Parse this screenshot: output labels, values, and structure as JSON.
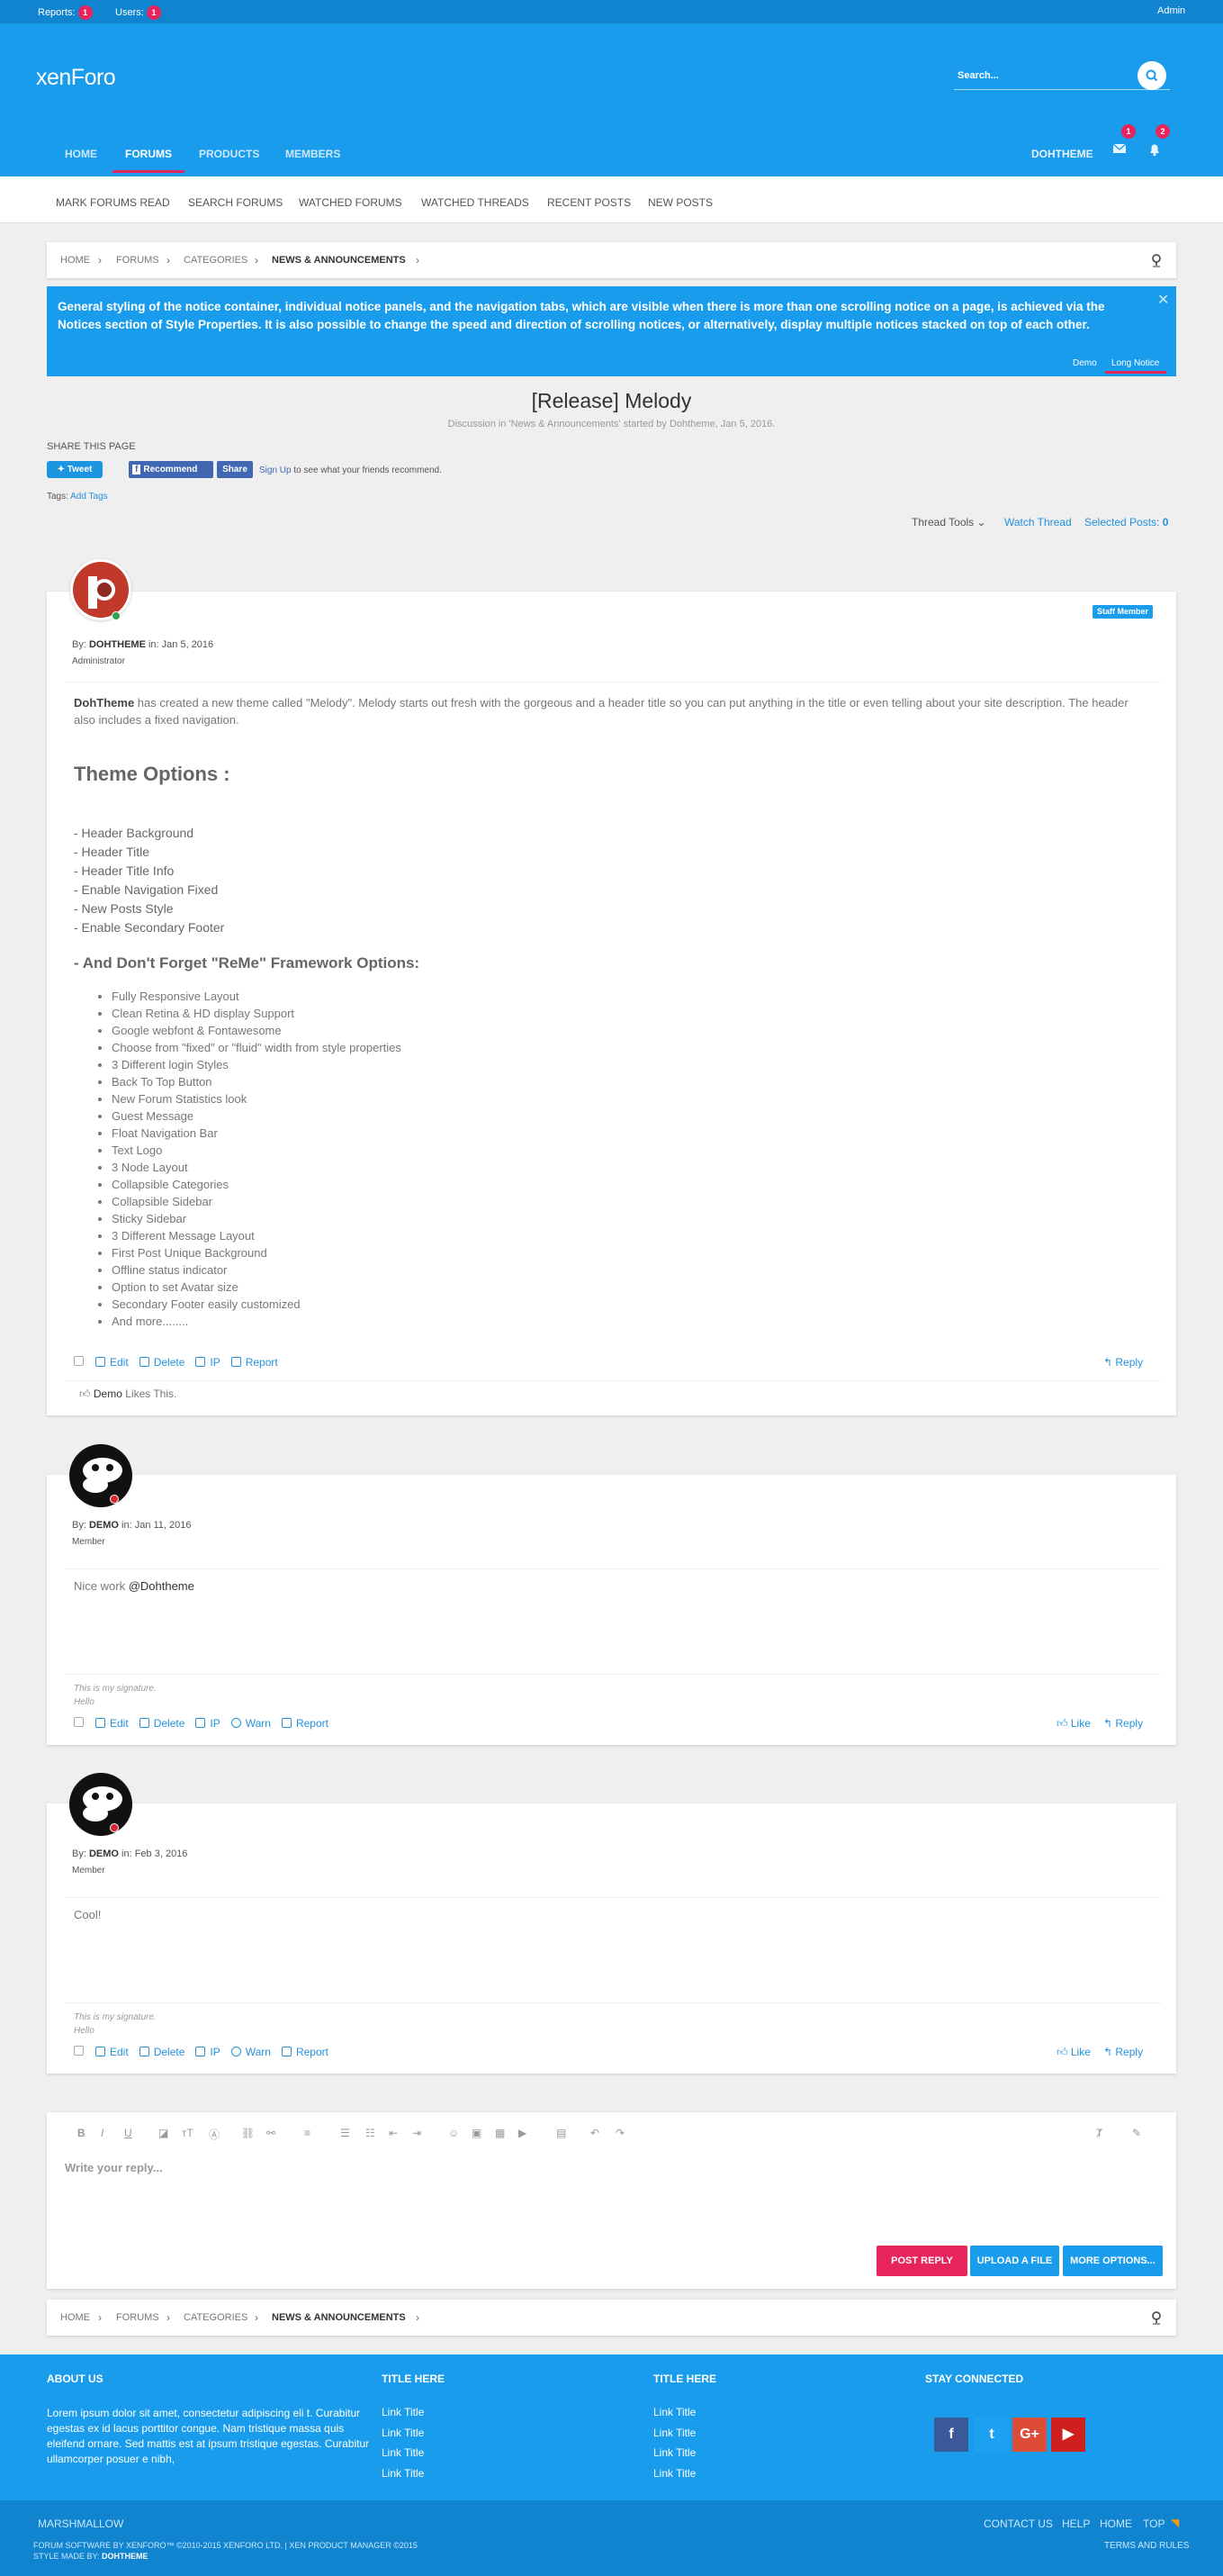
{
  "topbar": {
    "reports_label": "Reports:",
    "reports_count": "1",
    "users_label": "Users:",
    "users_count": "1",
    "admin": "Admin"
  },
  "header": {
    "logo": "xenForo",
    "search_placeholder": "Search...",
    "nav": [
      "HOME",
      "FORUMS",
      "PRODUCTS",
      "MEMBERS"
    ],
    "username": "DOHTHEME",
    "inbox_count": "1",
    "alerts_count": "2"
  },
  "subnav": [
    "MARK FORUMS READ",
    "SEARCH FORUMS",
    "WATCHED FORUMS",
    "WATCHED THREADS",
    "RECENT POSTS",
    "NEW POSTS"
  ],
  "breadcrumb": [
    "HOME",
    "FORUMS",
    "CATEGORIES",
    "NEWS & ANNOUNCEMENTS"
  ],
  "notice": {
    "text": "General styling of the notice container, individual notice panels, and the navigation tabs, which are visible when there is more than one scrolling notice on a page, is achieved via the Notices section of Style Properties. It is also possible to change the speed and direction of scrolling notices, or alternatively, display multiple notices stacked on top of each other.",
    "tabs": [
      "Demo",
      "Long Notice"
    ]
  },
  "thread": {
    "title": "[Release] Melody",
    "meta": "Discussion in 'News & Announcements' started by Dohtheme, Jan 5, 2016."
  },
  "share": {
    "title": "SHARE THIS PAGE",
    "tweet": "Tweet",
    "recommend": "Recommend",
    "share": "Share",
    "signup": "Sign Up",
    "signup_rest": "to see what your friends recommend.",
    "tags_label": "Tags:",
    "tags_link": "Add Tags"
  },
  "tools": {
    "thread_tools": "Thread Tools",
    "watch": "Watch Thread",
    "selected": "Selected Posts:",
    "selected_count": "0"
  },
  "post1": {
    "by": "By:",
    "author": "DOHTHEME",
    "in": "in: Jan 5, 2016",
    "role": "Administrator",
    "badge": "Staff Member",
    "intro_name": "DohTheme",
    "intro": " has created a new theme called \"Melody\". Melody starts out fresh with the gorgeous and a header title so you can put anything in the title or even telling about your site description. The header also includes a fixed navigation.",
    "options_title": "Theme Options :",
    "options": [
      "- Header Background",
      "- Header Title",
      "- Header Title Info",
      "- Enable Navigation Fixed",
      "- New Posts Style",
      "- Enable Secondary Footer"
    ],
    "framework_title": "- And Don't Forget \"ReMe\" Framework Options:",
    "features": [
      "Fully Responsive Layout",
      "Clean Retina & HD display Support",
      "Google webfont & Fontawesome",
      "Choose from \"fixed\" or \"fluid\" width from style properties",
      "3 Different login Styles",
      "Back To Top Button",
      "New Forum Statistics look",
      "Guest Message",
      "Float Navigation Bar",
      "Text Logo",
      "3 Node Layout",
      "Collapsible Categories",
      "Collapsible Sidebar",
      "Sticky Sidebar",
      "3 Different Message Layout",
      "First Post Unique Background",
      "Offline status indicator",
      "Option to set Avatar size",
      "Secondary Footer easily customized",
      "And more........"
    ],
    "actions": [
      "Edit",
      "Delete",
      "IP",
      "Report"
    ],
    "reply": "Reply",
    "likes_user": "Demo",
    "likes_rest": " Likes This."
  },
  "post2": {
    "by": "By:",
    "author": "DEMO",
    "in": "in: Jan 11, 2016",
    "role": "Member",
    "text": "Nice work ",
    "mention": "@Dohtheme",
    "sig1": "This is my signature.",
    "sig2": "Hello",
    "actions": [
      "Edit",
      "Delete",
      "IP",
      "Warn",
      "Report"
    ],
    "like": "Like",
    "reply": "Reply"
  },
  "post3": {
    "by": "By:",
    "author": "DEMO",
    "in": "in: Feb 3, 2016",
    "role": "Member",
    "text": "Cool!",
    "sig1": "This is my signature.",
    "sig2": "Hello",
    "actions": [
      "Edit",
      "Delete",
      "IP",
      "Warn",
      "Report"
    ],
    "like": "Like",
    "reply": "Reply"
  },
  "editor": {
    "placeholder": "Write your reply...",
    "post_reply": "POST REPLY",
    "upload": "UPLOAD A FILE",
    "more": "MORE OPTIONS..."
  },
  "footer": {
    "about_title": "ABOUT US",
    "about_text": "Lorem ipsum dolor sit amet, consectetur adipiscing eli t. Curabitur egestas ex id lacus porttitor congue. Nam tristique massa quis eleifend ornare. Sed mattis est at ipsum tristique egestas. Curabitur ullamcorper posuer e nibh,",
    "col2_title": "TITLE HERE",
    "col3_title": "TITLE HERE",
    "link": "Link Title",
    "stay": "STAY CONNECTED",
    "brand": "MARSHMALLOW",
    "links": [
      "CONTACT US",
      "HELP",
      "HOME",
      "TOP"
    ],
    "copyright": "FORUM SOFTWARE BY XENFORO™ ©2010-2015 XENFORO LTD. | XEN PRODUCT MANAGER ©2015",
    "style_by": "STYLE MADE BY:",
    "style_author": "DOHTHEME",
    "terms": "TERMS AND RULES"
  },
  "colors": {
    "primary": "#1a9cec",
    "dark": "#1184cf",
    "accent": "#e8245c",
    "link": "#2391dc"
  }
}
